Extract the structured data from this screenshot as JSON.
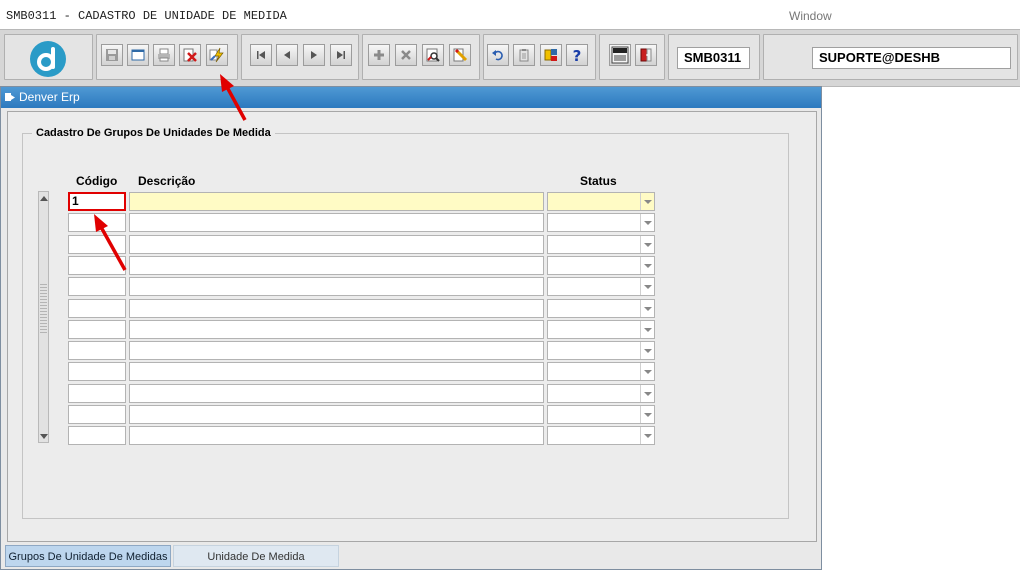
{
  "menubar": {
    "title": "SMB0311 - CADASTRO DE UNIDADE DE MEDIDA",
    "window_menu": "Window"
  },
  "toolbar": {
    "module_code": "SMB0311",
    "user": "SUPORTE@DESHB",
    "buttons": [
      {
        "id": "save",
        "icon": "floppy-icon"
      },
      {
        "id": "window",
        "icon": "window-icon"
      },
      {
        "id": "print",
        "icon": "printer-icon"
      },
      {
        "id": "exit",
        "icon": "exit-x-icon"
      },
      {
        "id": "execute",
        "icon": "lightning-icon"
      },
      {
        "id": "first",
        "icon": "first-record-icon"
      },
      {
        "id": "prev",
        "icon": "previous-record-icon"
      },
      {
        "id": "next",
        "icon": "next-record-icon"
      },
      {
        "id": "last",
        "icon": "last-record-icon"
      },
      {
        "id": "insert",
        "icon": "plus-icon"
      },
      {
        "id": "delete",
        "icon": "delete-x-icon"
      },
      {
        "id": "query",
        "icon": "search-query-icon"
      },
      {
        "id": "clear",
        "icon": "eraser-icon"
      },
      {
        "id": "undo",
        "icon": "undo-icon"
      },
      {
        "id": "paste",
        "icon": "clipboard-icon"
      },
      {
        "id": "list",
        "icon": "list-values-icon"
      },
      {
        "id": "help",
        "icon": "help-icon"
      },
      {
        "id": "menu",
        "icon": "menu-icon"
      },
      {
        "id": "logout",
        "icon": "door-exit-icon"
      }
    ]
  },
  "window": {
    "title": "Denver Erp",
    "frame_title": "Cadastro De Grupos De Unidades De Medida",
    "columns": {
      "codigo": "Código",
      "descricao": "Descrição",
      "status": "Status"
    },
    "rows": [
      {
        "codigo": "1",
        "descricao": "",
        "status": ""
      },
      {
        "codigo": "",
        "descricao": "",
        "status": ""
      },
      {
        "codigo": "",
        "descricao": "",
        "status": ""
      },
      {
        "codigo": "",
        "descricao": "",
        "status": ""
      },
      {
        "codigo": "",
        "descricao": "",
        "status": ""
      },
      {
        "codigo": "",
        "descricao": "",
        "status": ""
      },
      {
        "codigo": "",
        "descricao": "",
        "status": ""
      },
      {
        "codigo": "",
        "descricao": "",
        "status": ""
      },
      {
        "codigo": "",
        "descricao": "",
        "status": ""
      },
      {
        "codigo": "",
        "descricao": "",
        "status": ""
      },
      {
        "codigo": "",
        "descricao": "",
        "status": ""
      },
      {
        "codigo": "",
        "descricao": "",
        "status": ""
      }
    ]
  },
  "tabs": [
    {
      "label": "Grupos De Unidade De Medidas",
      "active": true
    },
    {
      "label": "Unidade De Medida",
      "active": false
    }
  ],
  "colors": {
    "title_bar": "#2c79bf",
    "selected_row": "#fffbc5",
    "annotation": "#e00000",
    "active_tab": "#bdd6ee"
  }
}
